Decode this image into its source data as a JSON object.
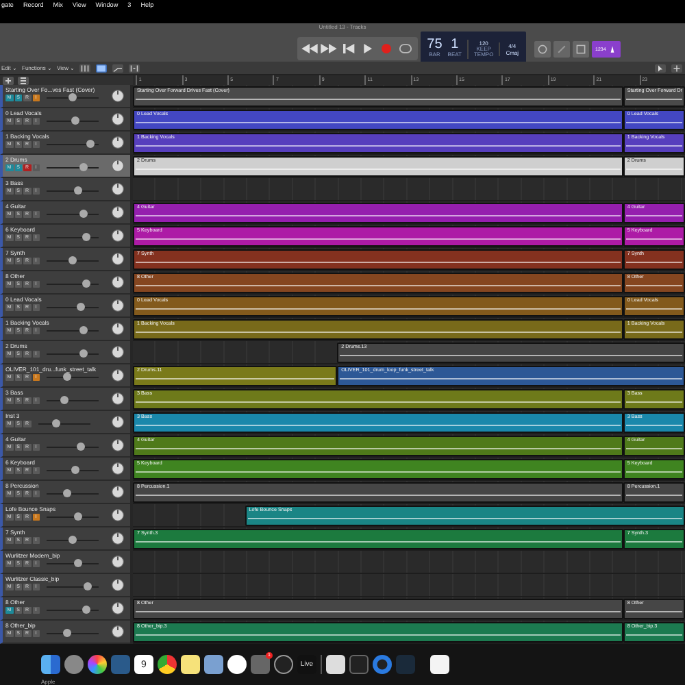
{
  "menu_bar": [
    "gate",
    "Record",
    "Mix",
    "View",
    "Window",
    "3",
    "Help"
  ],
  "window": {
    "title": "Untitled 13 - Tracks"
  },
  "lcd": {
    "bar": "75",
    "beat": "1",
    "bar_label": "BAR",
    "beat_label": "BEAT",
    "tempo": "120",
    "tempo_mode": "KEEP",
    "tempo_label": "TEMPO",
    "signature": "4/4",
    "key": "Cmaj"
  },
  "count_in": {
    "label": "1234",
    "on": true
  },
  "control_bar": {
    "menus": [
      "Edit ⌄",
      "Functions ⌄",
      "View ⌄"
    ]
  },
  "ruler": [
    "1",
    "3",
    "5",
    "7",
    "9",
    "11",
    "13",
    "15",
    "17",
    "19",
    "21",
    "23"
  ],
  "tracks": [
    {
      "name": "Starting Over Fo...ves Fast (Cover)",
      "selected": false,
      "level": 0.5,
      "buttons": [
        {
          "kind": "mute",
          "label": "M",
          "on": true
        },
        {
          "kind": "solo",
          "label": "S",
          "on": true
        },
        {
          "kind": "record",
          "label": "R",
          "on": false
        },
        {
          "kind": "input",
          "label": "I",
          "on": true
        }
      ],
      "regions": [
        {
          "name": "Starting Over Forward Drives Fast (Cover)",
          "kind": "main",
          "color": "#4a4a4a"
        },
        {
          "name": "Starting Over Forward Dr",
          "kind": "tail",
          "color": "#4a4a4a"
        }
      ]
    },
    {
      "name": "0 Lead Vocals",
      "selected": false,
      "level": 0.55,
      "buttons": [
        {
          "kind": "mute",
          "label": "M",
          "on": false
        },
        {
          "kind": "solo",
          "label": "S",
          "on": false
        },
        {
          "kind": "record",
          "label": "R",
          "on": false
        },
        {
          "kind": "input",
          "label": "I",
          "on": false
        }
      ],
      "regions": [
        {
          "name": "0 Lead Vocals",
          "kind": "main",
          "color": "#4347c2"
        },
        {
          "name": "0 Lead Vocals",
          "kind": "tail",
          "color": "#4347c2"
        }
      ]
    },
    {
      "name": "1 Backing Vocals",
      "selected": false,
      "level": 0.85,
      "buttons": [
        {
          "kind": "mute",
          "label": "M",
          "on": false
        },
        {
          "kind": "solo",
          "label": "S",
          "on": false
        },
        {
          "kind": "record",
          "label": "R",
          "on": false
        },
        {
          "kind": "input",
          "label": "I",
          "on": false
        }
      ],
      "regions": [
        {
          "name": "1 Backing Vocals",
          "kind": "main",
          "color": "#573fbd"
        },
        {
          "name": "1 Backing Vocals",
          "kind": "tail",
          "color": "#573fbd"
        }
      ]
    },
    {
      "name": "2 Drums",
      "selected": true,
      "level": 0.7,
      "buttons": [
        {
          "kind": "mute",
          "label": "M",
          "on": true
        },
        {
          "kind": "solo",
          "label": "S",
          "on": true
        },
        {
          "kind": "record",
          "label": "R",
          "on": true
        },
        {
          "kind": "input",
          "label": "I",
          "on": false
        }
      ],
      "regions": [
        {
          "name": "2 Drums",
          "kind": "main",
          "color": "#cfcfcf"
        },
        {
          "name": "2 Drums",
          "kind": "tail",
          "color": "#cfcfcf"
        }
      ]
    },
    {
      "name": "3 Bass",
      "selected": false,
      "level": 0.6,
      "buttons": [
        {
          "kind": "mute",
          "label": "M",
          "on": false
        },
        {
          "kind": "solo",
          "label": "S",
          "on": false
        },
        {
          "kind": "record",
          "label": "R",
          "on": false
        },
        {
          "kind": "input",
          "label": "I",
          "on": false
        }
      ]
    },
    {
      "name": "4 Guitar",
      "selected": false,
      "level": 0.7,
      "buttons": [
        {
          "kind": "mute",
          "label": "M",
          "on": false
        },
        {
          "kind": "solo",
          "label": "S",
          "on": false
        },
        {
          "kind": "record",
          "label": "R",
          "on": false
        },
        {
          "kind": "input",
          "label": "I",
          "on": false
        }
      ],
      "regions": [
        {
          "name": "4 Guitar",
          "kind": "main",
          "color": "#951fae"
        },
        {
          "name": "4 Guitar",
          "kind": "tail",
          "color": "#951fae"
        }
      ]
    },
    {
      "name": "6 Keyboard",
      "selected": false,
      "level": 0.75,
      "buttons": [
        {
          "kind": "mute",
          "label": "M",
          "on": false
        },
        {
          "kind": "solo",
          "label": "S",
          "on": false
        },
        {
          "kind": "record",
          "label": "R",
          "on": false
        },
        {
          "kind": "input",
          "label": "I",
          "on": false
        }
      ],
      "regions": [
        {
          "name": "5 Keyboard",
          "kind": "main",
          "color": "#ad1ba6"
        },
        {
          "name": "5 Keyboard",
          "kind": "tail",
          "color": "#ad1ba6"
        }
      ]
    },
    {
      "name": "7 Synth",
      "selected": false,
      "level": 0.5,
      "buttons": [
        {
          "kind": "mute",
          "label": "M",
          "on": false
        },
        {
          "kind": "solo",
          "label": "S",
          "on": false
        },
        {
          "kind": "record",
          "label": "R",
          "on": false
        },
        {
          "kind": "input",
          "label": "I",
          "on": false
        }
      ],
      "regions": [
        {
          "name": "7 Synth",
          "kind": "main",
          "color": "#84311f"
        },
        {
          "name": "7 Synth",
          "kind": "tail",
          "color": "#84311f"
        }
      ]
    },
    {
      "name": "8 Other",
      "selected": false,
      "level": 0.75,
      "buttons": [
        {
          "kind": "mute",
          "label": "M",
          "on": false
        },
        {
          "kind": "solo",
          "label": "S",
          "on": false
        },
        {
          "kind": "record",
          "label": "R",
          "on": false
        },
        {
          "kind": "input",
          "label": "I",
          "on": false
        }
      ],
      "regions": [
        {
          "name": "8 Other",
          "kind": "main",
          "color": "#854620"
        },
        {
          "name": "8 Other",
          "kind": "tail",
          "color": "#854620"
        }
      ]
    },
    {
      "name": "0 Lead Vocals",
      "selected": false,
      "level": 0.65,
      "buttons": [
        {
          "kind": "mute",
          "label": "M",
          "on": false
        },
        {
          "kind": "solo",
          "label": "S",
          "on": false
        },
        {
          "kind": "record",
          "label": "R",
          "on": false
        },
        {
          "kind": "input",
          "label": "I",
          "on": false
        }
      ],
      "regions": [
        {
          "name": "0 Lead Vocals",
          "kind": "main",
          "color": "#835a1c"
        },
        {
          "name": "0 Lead Vocals",
          "kind": "tail",
          "color": "#835a1c"
        }
      ]
    },
    {
      "name": "1 Backing Vocals",
      "selected": false,
      "level": 0.7,
      "buttons": [
        {
          "kind": "mute",
          "label": "M",
          "on": false
        },
        {
          "kind": "solo",
          "label": "S",
          "on": false
        },
        {
          "kind": "record",
          "label": "R",
          "on": false
        },
        {
          "kind": "input",
          "label": "I",
          "on": false
        }
      ],
      "regions": [
        {
          "name": "1 Backing Vocals",
          "kind": "main",
          "color": "#786a1a"
        },
        {
          "name": "1 Backing Vocals",
          "kind": "tail",
          "color": "#786a1a"
        }
      ]
    },
    {
      "name": "2 Drums",
      "selected": false,
      "level": 0.7,
      "buttons": [
        {
          "kind": "mute",
          "label": "M",
          "on": false
        },
        {
          "kind": "solo",
          "label": "S",
          "on": false
        },
        {
          "kind": "record",
          "label": "R",
          "on": false
        },
        {
          "kind": "input",
          "label": "I",
          "on": false
        }
      ],
      "regions": [
        {
          "name": "2 Drums.13",
          "kind": "late",
          "color": "#454545"
        }
      ]
    },
    {
      "name": "OLIVER_101_dru...funk_street_talk",
      "selected": false,
      "level": 0.4,
      "buttons": [
        {
          "kind": "mute",
          "label": "M",
          "on": false
        },
        {
          "kind": "solo",
          "label": "S",
          "on": false
        },
        {
          "kind": "record",
          "label": "R",
          "on": false
        },
        {
          "kind": "input",
          "label": "I",
          "on": true
        }
      ],
      "regions": [
        {
          "name": "2 Drums.11",
          "kind": "early",
          "color": "#7a7a1a"
        },
        {
          "name": "OLIVER_101_drum_loop_funk_street_talk",
          "kind": "late",
          "color": "#2d5896"
        }
      ]
    },
    {
      "name": "3 Bass",
      "selected": false,
      "level": 0.35,
      "buttons": [
        {
          "kind": "mute",
          "label": "M",
          "on": false
        },
        {
          "kind": "solo",
          "label": "S",
          "on": false
        },
        {
          "kind": "record",
          "label": "R",
          "on": false
        },
        {
          "kind": "input",
          "label": "I",
          "on": false
        }
      ],
      "regions": [
        {
          "name": "3 Bass",
          "kind": "main",
          "color": "#6e7a1a"
        },
        {
          "name": "3 Bass",
          "kind": "tail",
          "color": "#6e7a1a"
        }
      ]
    },
    {
      "name": "Inst 3",
      "selected": false,
      "level": 0.35,
      "buttons": [
        {
          "kind": "mute",
          "label": "M",
          "on": false
        },
        {
          "kind": "solo",
          "label": "S",
          "on": false
        },
        {
          "kind": "record",
          "label": "R",
          "on": false
        }
      ],
      "regions": [
        {
          "name": "3 Bass",
          "kind": "main",
          "color": "#1a88ab"
        },
        {
          "name": "3 Bass",
          "kind": "tail",
          "color": "#1a88ab"
        }
      ]
    },
    {
      "name": "4 Guitar",
      "selected": false,
      "level": 0.65,
      "buttons": [
        {
          "kind": "mute",
          "label": "M",
          "on": false
        },
        {
          "kind": "solo",
          "label": "S",
          "on": false
        },
        {
          "kind": "record",
          "label": "R",
          "on": false
        },
        {
          "kind": "input",
          "label": "I",
          "on": false
        }
      ],
      "regions": [
        {
          "name": "4 Guitar",
          "kind": "main",
          "color": "#4f7a1a"
        },
        {
          "name": "4 Guitar",
          "kind": "tail",
          "color": "#4f7a1a"
        }
      ]
    },
    {
      "name": "6 Keyboard",
      "selected": false,
      "level": 0.55,
      "buttons": [
        {
          "kind": "mute",
          "label": "M",
          "on": false
        },
        {
          "kind": "solo",
          "label": "S",
          "on": false
        },
        {
          "kind": "record",
          "label": "R",
          "on": false
        },
        {
          "kind": "input",
          "label": "I",
          "on": false
        }
      ],
      "regions": [
        {
          "name": "5 Keyboard",
          "kind": "main",
          "color": "#3f8420"
        },
        {
          "name": "5 Keyboard",
          "kind": "tail",
          "color": "#3f8420"
        }
      ]
    },
    {
      "name": "8 Percussion",
      "selected": false,
      "level": 0.4,
      "buttons": [
        {
          "kind": "mute",
          "label": "M",
          "on": false
        },
        {
          "kind": "solo",
          "label": "S",
          "on": false
        },
        {
          "kind": "record",
          "label": "R",
          "on": false
        },
        {
          "kind": "input",
          "label": "I",
          "on": false
        }
      ],
      "regions": [
        {
          "name": "8 Percussion.1",
          "kind": "main",
          "color": "#464646"
        },
        {
          "name": "8 Percussion.1",
          "kind": "tail",
          "color": "#464646"
        }
      ]
    },
    {
      "name": "Lofe Bounce Snaps",
      "selected": false,
      "level": 0.6,
      "buttons": [
        {
          "kind": "mute",
          "label": "M",
          "on": false
        },
        {
          "kind": "solo",
          "label": "S",
          "on": false
        },
        {
          "kind": "record",
          "label": "R",
          "on": false
        },
        {
          "kind": "input",
          "label": "I",
          "on": true
        }
      ],
      "regions": [
        {
          "name": "Lofe Bounce Snaps",
          "kind": "mid",
          "color": "#1a8585"
        }
      ]
    },
    {
      "name": "7 Synth",
      "selected": false,
      "level": 0.5,
      "buttons": [
        {
          "kind": "mute",
          "label": "M",
          "on": false
        },
        {
          "kind": "solo",
          "label": "S",
          "on": false
        },
        {
          "kind": "record",
          "label": "R",
          "on": false
        },
        {
          "kind": "input",
          "label": "I",
          "on": false
        }
      ],
      "regions": [
        {
          "name": "7 Synth.3",
          "kind": "main",
          "color": "#1c7a3e"
        },
        {
          "name": "7 Synth.3",
          "kind": "tail",
          "color": "#1c7a3e"
        }
      ]
    },
    {
      "name": "Wurlitzer Modern_bip",
      "selected": false,
      "level": 0.6,
      "buttons": [
        {
          "kind": "mute",
          "label": "M",
          "on": false
        },
        {
          "kind": "solo",
          "label": "S",
          "on": false
        },
        {
          "kind": "record",
          "label": "R",
          "on": false
        },
        {
          "kind": "input",
          "label": "I",
          "on": false
        }
      ]
    },
    {
      "name": "Wurlitzer Classic_bip",
      "selected": false,
      "level": 0.8,
      "buttons": [
        {
          "kind": "mute",
          "label": "M",
          "on": false
        },
        {
          "kind": "solo",
          "label": "S",
          "on": false
        },
        {
          "kind": "record",
          "label": "R",
          "on": false
        },
        {
          "kind": "input",
          "label": "I",
          "on": false
        }
      ]
    },
    {
      "name": "8 Other",
      "selected": false,
      "level": 0.75,
      "buttons": [
        {
          "kind": "mute",
          "label": "M",
          "on": true
        },
        {
          "kind": "solo",
          "label": "S",
          "on": false
        },
        {
          "kind": "record",
          "label": "R",
          "on": false
        },
        {
          "kind": "input",
          "label": "I",
          "on": false
        }
      ],
      "regions": [
        {
          "name": "8 Other",
          "kind": "main",
          "color": "#464646"
        },
        {
          "name": "8 Other",
          "kind": "tail",
          "color": "#464646"
        }
      ]
    },
    {
      "name": "8 Other_bip",
      "selected": false,
      "level": 0.4,
      "buttons": [
        {
          "kind": "mute",
          "label": "M",
          "on": false
        },
        {
          "kind": "solo",
          "label": "S",
          "on": false
        },
        {
          "kind": "record",
          "label": "R",
          "on": false
        },
        {
          "kind": "input",
          "label": "I",
          "on": false
        }
      ],
      "regions": [
        {
          "name": "8 Other_bip.3",
          "kind": "main",
          "color": "#1c7a50"
        },
        {
          "name": "8 Other_bip.3",
          "kind": "tail",
          "color": "#1c7a50"
        }
      ]
    }
  ],
  "dock": {
    "hover_label": "Apple",
    "calendar_day": "9",
    "badge": "1",
    "live": "Live"
  }
}
